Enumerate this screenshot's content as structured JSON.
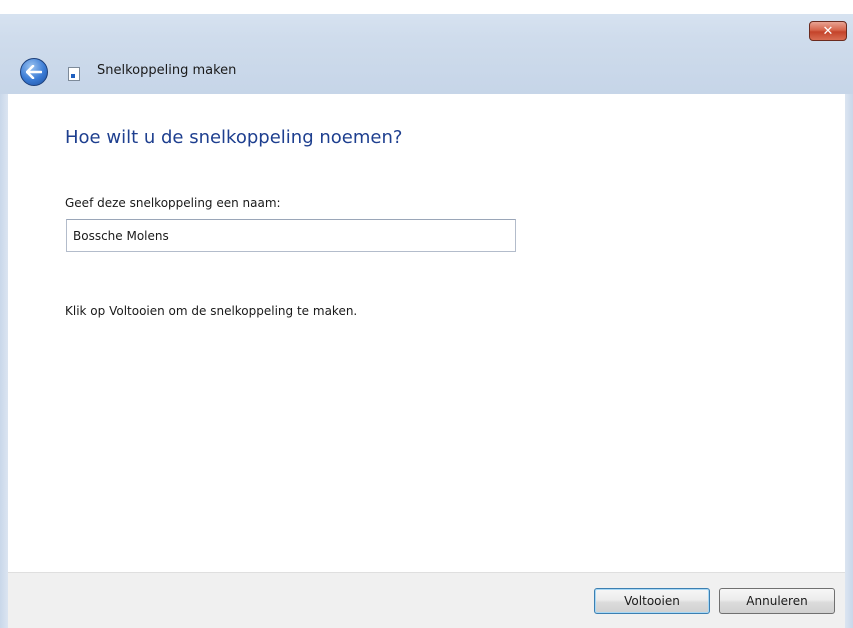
{
  "window": {
    "title": "Snelkoppeling maken",
    "close_glyph": "✕"
  },
  "icons": {
    "back": "back-arrow-icon",
    "title": "shortcut-icon",
    "close": "close-icon"
  },
  "main": {
    "heading": "Hoe wilt u de snelkoppeling noemen?",
    "field_label": "Geef deze snelkoppeling een naam:",
    "name_value": "Bossche Molens",
    "instruction": "Klik op Voltooien om de snelkoppeling te maken."
  },
  "footer": {
    "finish_label": "Voltooien",
    "cancel_label": "Annuleren"
  },
  "colors": {
    "heading": "#1e3f8f",
    "close_button": "#c4432a",
    "back_button": "#3a7bd5"
  }
}
